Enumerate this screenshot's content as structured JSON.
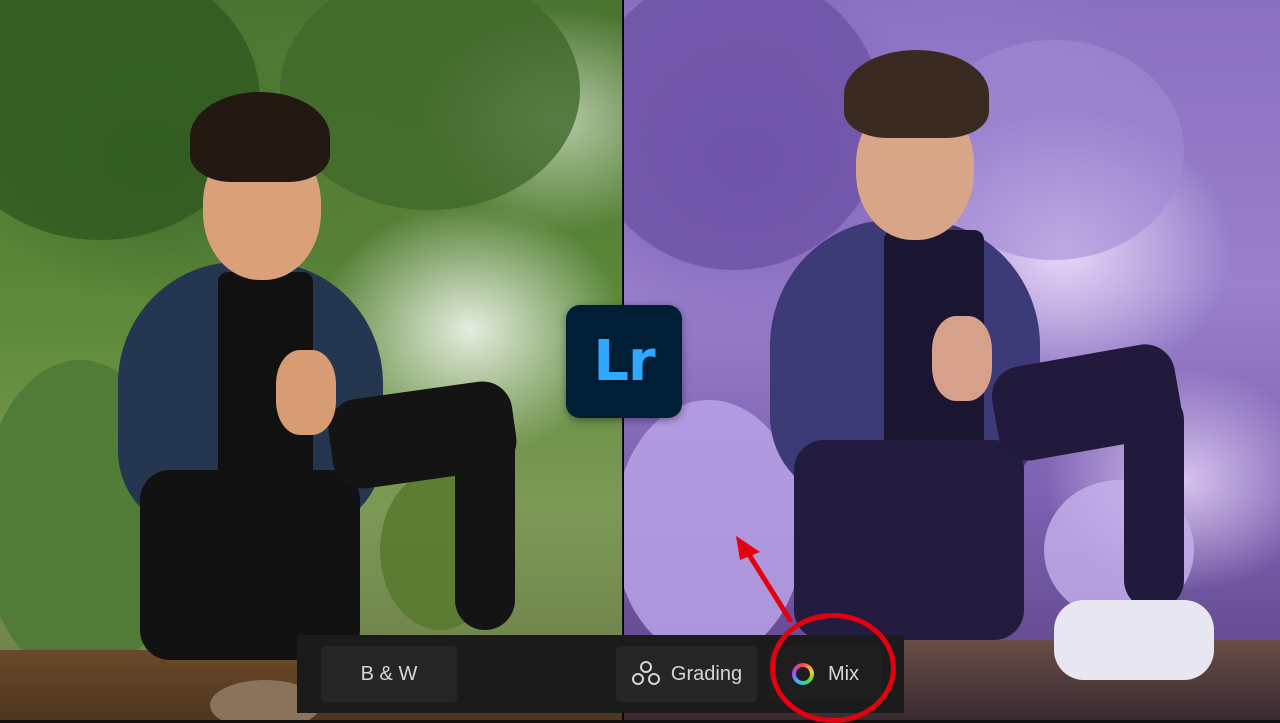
{
  "logo": {
    "text": "Lr"
  },
  "toolbar": {
    "bw_label": "B & W",
    "grading_label": "Grading",
    "mix_label": "Mix"
  },
  "colors": {
    "logo_bg": "#001e36",
    "logo_text": "#31a8ff",
    "highlight": "#e3000f",
    "toolbar_bg": "#1b1b1b"
  },
  "icons": [
    "grading-icon",
    "color-mix-icon"
  ]
}
